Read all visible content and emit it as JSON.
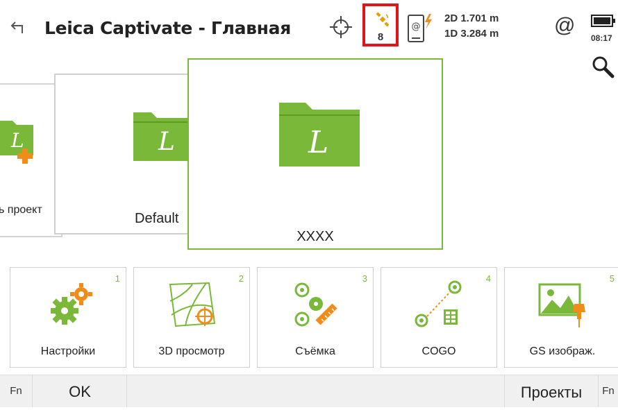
{
  "header": {
    "title": "Leica Captivate - Главная",
    "satellite_count": "8",
    "precision_2d": "2D 1.701 m",
    "precision_1d": "1D 3.284 m",
    "at_symbol": "@",
    "time": "08:17"
  },
  "projects": {
    "left_label": "ь проект",
    "middle_label": "Default",
    "selected_label": "XXXX"
  },
  "tiles": [
    {
      "label": "Настройки",
      "number": "1",
      "icon": "gears-icon"
    },
    {
      "label": "3D просмотр",
      "number": "2",
      "icon": "3d-map-icon"
    },
    {
      "label": "Съёмка",
      "number": "3",
      "icon": "survey-icon"
    },
    {
      "label": "COGO",
      "number": "4",
      "icon": "cogo-icon"
    },
    {
      "label": "GS изображ.",
      "number": "5",
      "icon": "gs-image-icon"
    }
  ],
  "bottombar": {
    "fn_left": "Fn",
    "ok": "OK",
    "projects": "Проекты",
    "fn_right": "Fn"
  },
  "colors": {
    "accent_green": "#7ab83a",
    "highlight_red": "#e1141c",
    "accent_orange": "#f08c1a"
  }
}
